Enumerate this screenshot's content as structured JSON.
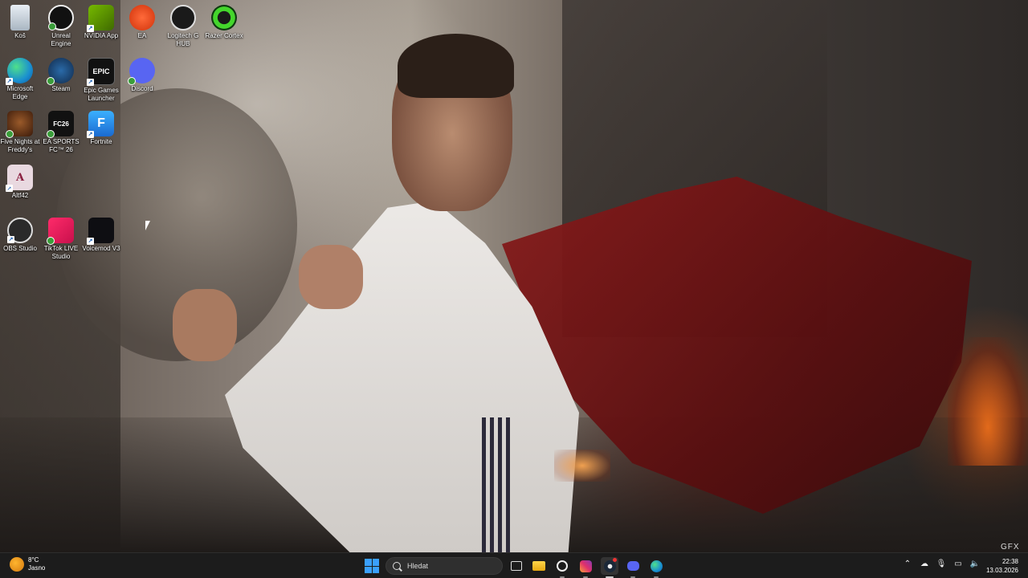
{
  "wallpaper": {
    "watermark": "GFX"
  },
  "desktop_icons": [
    {
      "label": "Koš",
      "icon": "recycle-bin-icon"
    },
    {
      "label": "Unreal Engine",
      "icon": "unreal-engine-icon"
    },
    {
      "label": "NVIDIA App",
      "icon": "nvidia-icon"
    },
    {
      "label": "EA",
      "icon": "ea-icon"
    },
    {
      "label": "Logitech G HUB",
      "icon": "logitech-icon"
    },
    {
      "label": "Razer Cortex",
      "icon": "razer-cortex-icon"
    },
    {
      "label": "Microsoft Edge",
      "icon": "edge-icon"
    },
    {
      "label": "Steam",
      "icon": "steam-icon"
    },
    {
      "label": "Epic Games Launcher",
      "icon": "epic-games-icon"
    },
    {
      "label": "Discord",
      "icon": "discord-icon"
    },
    {
      "label": "Five Nights at Freddy's",
      "icon": "fnaf-icon"
    },
    {
      "label": "EA SPORTS FC™ 26",
      "icon": "ea-sports-fc-icon"
    },
    {
      "label": "Fortnite",
      "icon": "fortnite-icon"
    },
    {
      "label": "Altf42",
      "icon": "altf42-icon"
    },
    {
      "label": "OBS Studio",
      "icon": "obs-icon"
    },
    {
      "label": "TikTok LIVE Studio",
      "icon": "tiktok-icon"
    },
    {
      "label": "Voicemod V3",
      "icon": "voicemod-icon"
    }
  ],
  "icon_glyphs": {
    "epic": "EPIC",
    "fc": "FC26",
    "fortnite": "F",
    "altf42": "A"
  },
  "taskbar": {
    "weather": {
      "temp": "8°C",
      "condition": "Jasno"
    },
    "search_placeholder": "Hledat",
    "apps": [
      "task-view-icon",
      "file-explorer-icon",
      "logitech-ghub-icon",
      "instagram-icon",
      "steam-icon",
      "discord-icon",
      "edge-icon"
    ],
    "clock": {
      "time": "22:38",
      "date": "13.03.2026"
    }
  },
  "colors": {
    "taskbar": "#1c1c1c",
    "accent": "#3aa0ff"
  }
}
